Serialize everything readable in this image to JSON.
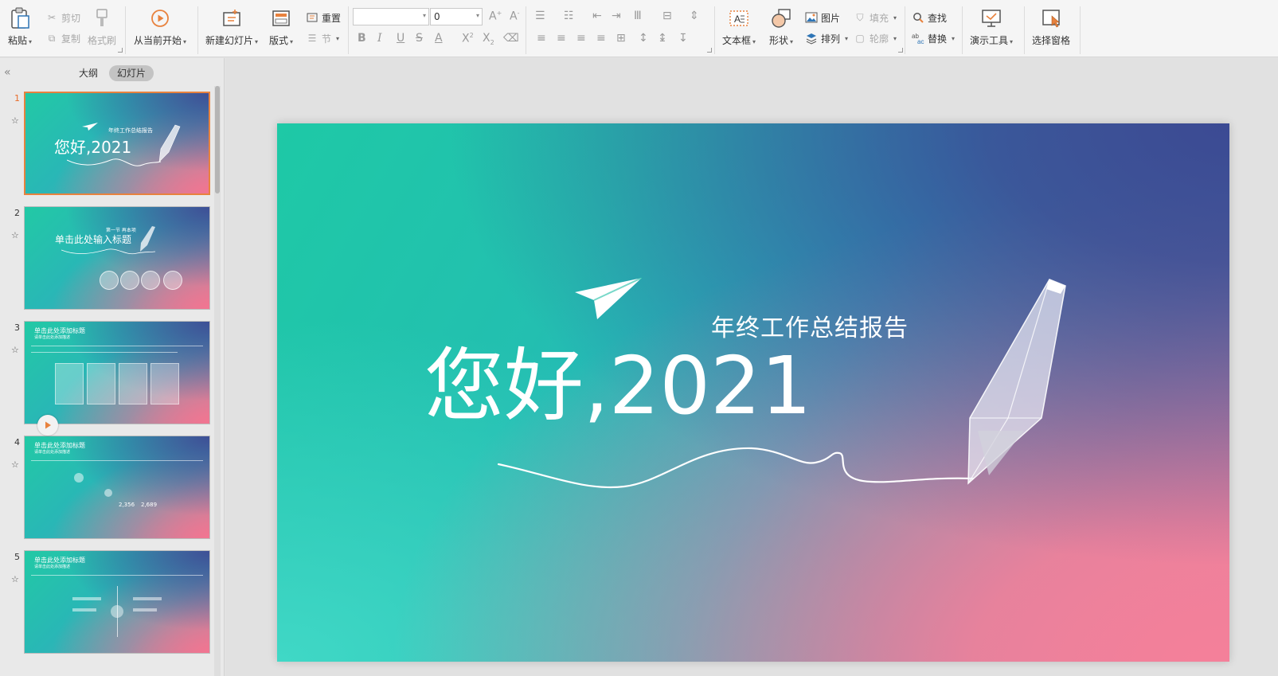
{
  "ribbon": {
    "clipboard": {
      "paste": "粘贴",
      "cut": "剪切",
      "copy": "复制",
      "format_painter": "格式刷"
    },
    "start_from_current": "从当前开始",
    "new_slide": "新建幻灯片",
    "layout": "版式",
    "reset": "重置",
    "section": "节",
    "font_name": "",
    "font_size": "0",
    "textbox": "文本框",
    "shape": "形状",
    "picture": "图片",
    "arrange": "排列",
    "fill": "填充",
    "outline": "轮廓",
    "find": "查找",
    "replace": "替换",
    "presentation_tools": "演示工具",
    "selection_pane": "选择窗格"
  },
  "panel": {
    "tabs": [
      {
        "label": "大纲"
      },
      {
        "label": "幻灯片"
      }
    ],
    "slides": [
      {
        "number": "1",
        "subtitle": "年终工作总结报告",
        "title": "您好,2021"
      },
      {
        "number": "2",
        "subtitle": "第一节  再本项",
        "title": "单击此处输入标题"
      },
      {
        "number": "3",
        "title": "单击此处添加标题",
        "caption": "请单击此处添加描述"
      },
      {
        "number": "4",
        "title": "单击此处添加标题",
        "caption": "请单击此处添加描述",
        "stats": [
          "2,356",
          "2,689"
        ]
      },
      {
        "number": "5",
        "title": "单击此处添加标题",
        "caption": "请单击此处添加描述"
      }
    ]
  },
  "slide": {
    "subtitle": "年终工作总结报告",
    "title": "您好,2021"
  },
  "colors": {
    "accent": "#e8823e",
    "slide_teal": "#1ec9a6",
    "slide_blue": "#3b4a93",
    "slide_pink": "#f4809a"
  }
}
